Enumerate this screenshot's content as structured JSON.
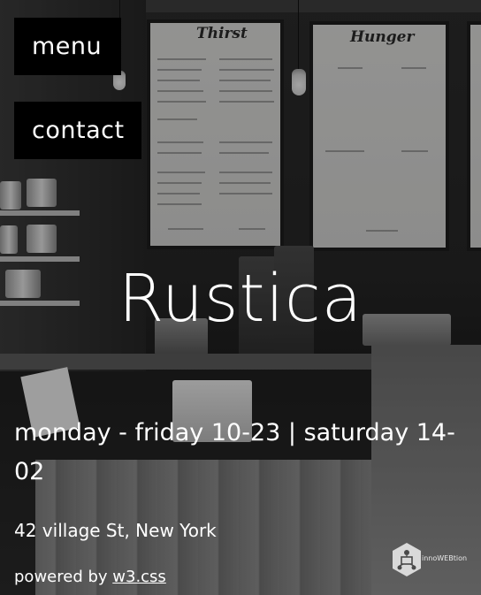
{
  "nav": {
    "menu_label": "menu",
    "contact_label": "contact"
  },
  "hero": {
    "title": "Rustica",
    "hours": "monday - friday 10-23 | saturday 14-02",
    "address": "42 village St, New York"
  },
  "footer": {
    "powered_prefix": "powered by ",
    "powered_link": "w3.css",
    "badge_text": "innoWEBtion",
    "badge_icon": "hexagon-network-icon"
  },
  "background": {
    "board_1_title": "Thirst",
    "board_2_title": "Hunger"
  },
  "colors": {
    "button_bg": "#000000",
    "text": "#ffffff"
  }
}
